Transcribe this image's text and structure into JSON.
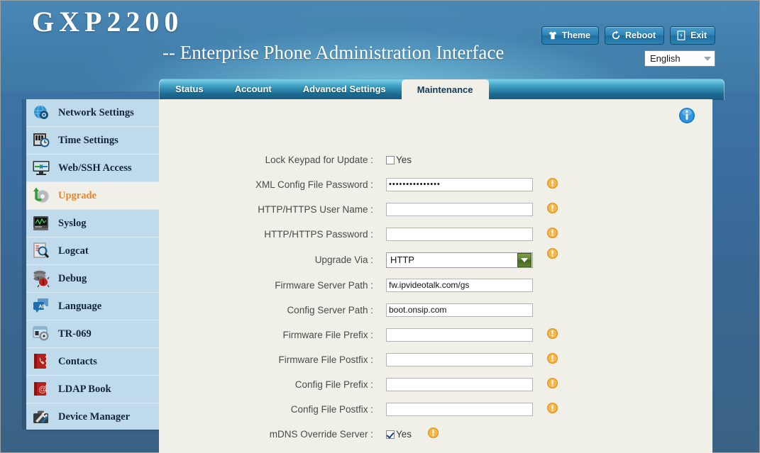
{
  "header": {
    "logo": "GXP2200",
    "subtitle": "-- Enterprise Phone Administration Interface",
    "buttons": [
      {
        "label": "Theme",
        "icon": "tshirt-icon"
      },
      {
        "label": "Reboot",
        "icon": "refresh-icon"
      },
      {
        "label": "Exit",
        "icon": "exit-door-icon"
      }
    ],
    "language": {
      "value": "English",
      "icon": "chevron-down-icon"
    }
  },
  "tabs": [
    {
      "label": "Status",
      "active": false
    },
    {
      "label": "Account",
      "active": false
    },
    {
      "label": "Advanced Settings",
      "active": false
    },
    {
      "label": "Maintenance",
      "active": true
    }
  ],
  "sidebar": {
    "items": [
      {
        "label": "Network Settings",
        "icon": "globe-gear-icon",
        "active": false
      },
      {
        "label": "Time Settings",
        "icon": "clock-calendar-icon",
        "active": false
      },
      {
        "label": "Web/SSH Access",
        "icon": "monitor-arrows-icon",
        "active": false
      },
      {
        "label": "Upgrade",
        "icon": "upgrade-disc-icon",
        "active": true
      },
      {
        "label": "Syslog",
        "icon": "syslog-monitor-icon",
        "active": false
      },
      {
        "label": "Logcat",
        "icon": "magnifier-doc-icon",
        "active": false
      },
      {
        "label": "Debug",
        "icon": "bug-stack-icon",
        "active": false
      },
      {
        "label": "Language",
        "icon": "ab-translate-icon",
        "active": false
      },
      {
        "label": "TR-069",
        "icon": "server-gear-icon",
        "active": false
      },
      {
        "label": "Contacts",
        "icon": "phone-book-icon",
        "active": false
      },
      {
        "label": "LDAP Book",
        "icon": "at-book-icon",
        "active": false
      },
      {
        "label": "Device Manager",
        "icon": "toolbox-icon",
        "active": false
      }
    ]
  },
  "content": {
    "info_icon": "info-icon",
    "warning_icon": "warning-icon",
    "fields": [
      {
        "label": "Lock Keypad for Update :",
        "type": "checkbox",
        "checked": false,
        "checkbox_label": "Yes",
        "warn": false
      },
      {
        "label": "XML Config File Password :",
        "type": "password",
        "value": "•••••••••••••••",
        "warn": true
      },
      {
        "label": "HTTP/HTTPS User Name :",
        "type": "text",
        "value": "",
        "warn": true
      },
      {
        "label": "HTTP/HTTPS Password :",
        "type": "password",
        "value": "",
        "warn": true
      },
      {
        "label": "Upgrade Via :",
        "type": "select",
        "value": "HTTP",
        "warn": true
      },
      {
        "label": "Firmware Server Path :",
        "type": "text",
        "value": "fw.ipvideotalk.com/gs",
        "warn": false
      },
      {
        "label": "Config Server Path :",
        "type": "text",
        "value": "boot.onsip.com",
        "warn": false
      },
      {
        "label": "Firmware File Prefix :",
        "type": "text",
        "value": "",
        "warn": true
      },
      {
        "label": "Firmware File Postfix :",
        "type": "text",
        "value": "",
        "warn": true
      },
      {
        "label": "Config File Prefix :",
        "type": "text",
        "value": "",
        "warn": true
      },
      {
        "label": "Config File Postfix :",
        "type": "text",
        "value": "",
        "warn": true
      },
      {
        "label": "mDNS Override Server :",
        "type": "checkbox",
        "checked": true,
        "checkbox_label": "Yes",
        "warn": true
      }
    ]
  },
  "colors": {
    "accent_orange": "#e8872b",
    "panel_bg": "#f0f0e8",
    "sidebar_bg": "#bfdbeb",
    "page_bg": "#3a6a95",
    "warning": "#f0a030"
  }
}
